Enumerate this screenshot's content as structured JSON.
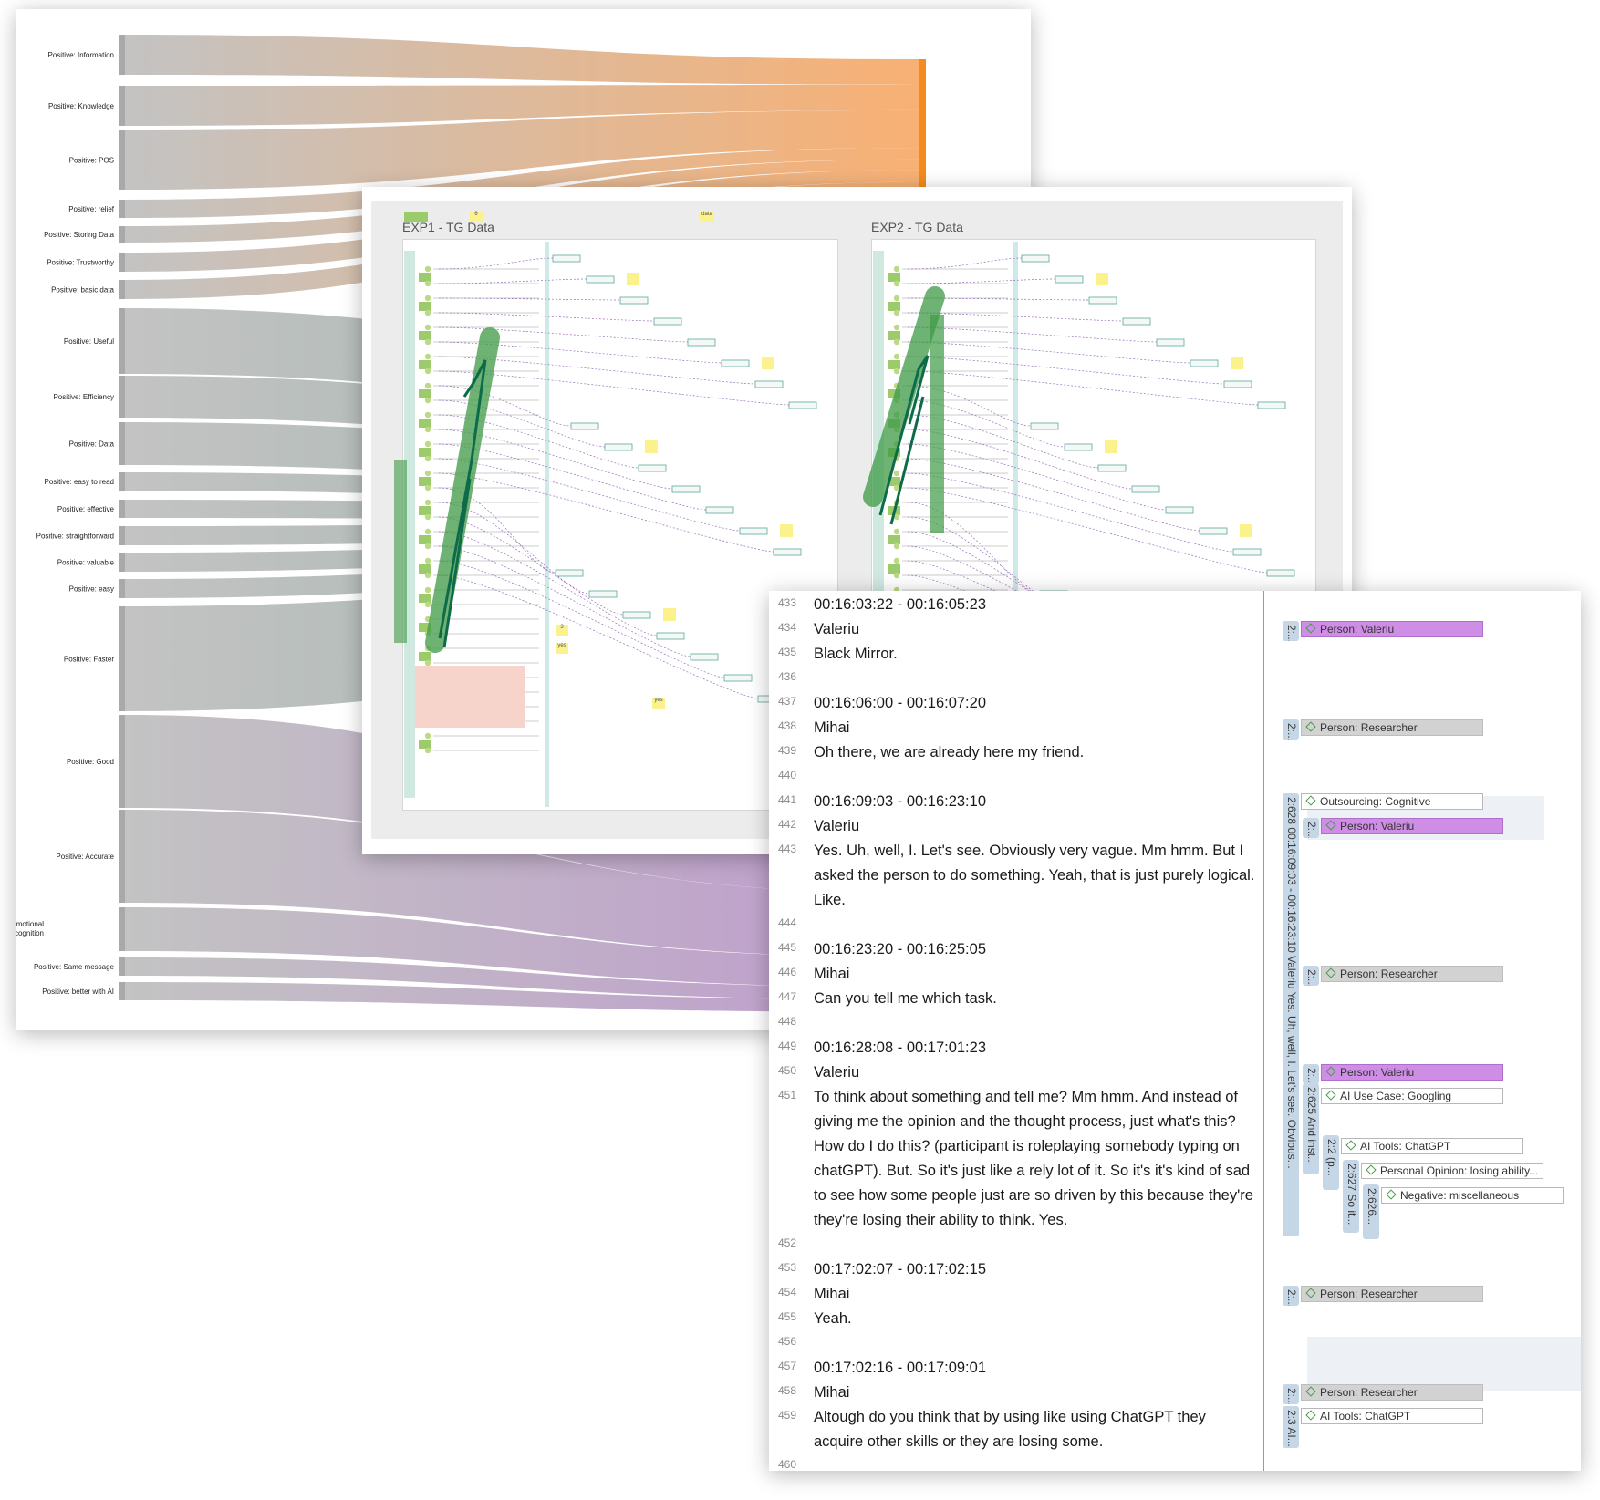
{
  "sankey": {
    "labels": [
      "Positive: Information",
      "Positive: Knowledge",
      "Positive: POS",
      "Positive: relief",
      "Positive: Storing Data",
      "Positive: Trustworthy",
      "Positive: basic data",
      "Positive: Useful",
      "Positive: Efficiency",
      "Positive: Data",
      "Positive: easy to read",
      "Positive: effective",
      "Positive: straightforward",
      "Positive: valuable",
      "Positive: easy",
      "Positive: Faster",
      "Positive: Good",
      "Positive: Accurate",
      "Positive: Emotional recognition",
      "Positive: Same message",
      "Positive: better with AI"
    ],
    "colors": {
      "orange": "#f7a35c",
      "orange_node": "#f58a1f",
      "green": "#8aa69a",
      "purple": "#b48bc5",
      "source": "#b9b9b9"
    }
  },
  "board": {
    "exp1_title": "EXP1 - TG Data",
    "exp2_title": "EXP2 - TG Data",
    "sticky_data": "data",
    "sticky_yes1": "yes",
    "sticky_yes2": "yes",
    "sticky_3": "3",
    "sticky_6": "6",
    "colors": {
      "marker": "#3d9a45",
      "ink": "#0d6b4a",
      "sticky": "#fbf28c",
      "green_card": "#9ccb6c"
    }
  },
  "transcript": {
    "lines": [
      {
        "n": "433",
        "text": "00:16:03:22 - 00:16:05:23"
      },
      {
        "n": "434",
        "text": "Valeriu"
      },
      {
        "n": "435",
        "text": "Black Mirror."
      },
      {
        "n": "436",
        "text": ""
      },
      {
        "n": "437",
        "text": "00:16:06:00 - 00:16:07:20"
      },
      {
        "n": "438",
        "text": "Mihai"
      },
      {
        "n": "439",
        "text": "Oh there, we are already here my friend."
      },
      {
        "n": "440",
        "text": ""
      },
      {
        "n": "441",
        "text": "00:16:09:03 - 00:16:23:10"
      },
      {
        "n": "442",
        "text": "Valeriu"
      },
      {
        "n": "443",
        "text": "Yes. Uh, well, I. Let's see. Obviously very vague. Mm hmm. But I asked the person to do something. Yeah, that is just purely logical. Like."
      },
      {
        "n": "444",
        "text": ""
      },
      {
        "n": "445",
        "text": "00:16:23:20 - 00:16:25:05"
      },
      {
        "n": "446",
        "text": "Mihai"
      },
      {
        "n": "447",
        "text": "Can you tell me which task."
      },
      {
        "n": "448",
        "text": ""
      },
      {
        "n": "449",
        "text": "00:16:28:08 - 00:17:01:23"
      },
      {
        "n": "450",
        "text": "Valeriu"
      },
      {
        "n": "451",
        "text": "To think about something and tell me? Mm hmm. And instead of giving me the opinion and the thought process, just what's this? How do I do this? (participant is roleplaying somebody typing on chatGPT). But. So it's just like a rely lot of it. So it's it's kind of sad to see how some people just are so driven by this because they're they're losing their ability to think. Yes."
      },
      {
        "n": "452",
        "text": ""
      },
      {
        "n": "453",
        "text": "00:17:02:07 - 00:17:02:15"
      },
      {
        "n": "454",
        "text": "Mihai"
      },
      {
        "n": "455",
        "text": "Yeah."
      },
      {
        "n": "456",
        "text": ""
      },
      {
        "n": "457",
        "text": "00:17:02:16 - 00:17:09:01"
      },
      {
        "n": "458",
        "text": "Mihai"
      },
      {
        "n": "459",
        "text": "Altough do you think that by using like using ChatGPT they acquire other skills or they are losing some."
      },
      {
        "n": "460",
        "text": ""
      }
    ],
    "quote_bars": [
      "2:...",
      "2:...",
      "2:628 00:16:09:03 - 00:16:23:10 Valeriu Yes. Uh, well, I. Let's see. Obvious...",
      "2:...",
      "2:...",
      "2:...",
      "2:625 And inst...",
      "2:2 (p...",
      "2:627 So it...",
      "2:626...",
      "2:...",
      "2:...",
      "2:3 AI..."
    ],
    "codes": [
      "Person: Valeriu",
      "Person: Researcher",
      "Outsourcing: Cognitive",
      "Person: Valeriu",
      "Person: Researcher",
      "Person: Valeriu",
      "AI Use Case: Googling",
      "AI Tools: ChatGPT",
      "Personal Opinion: losing ability...",
      "Negative: miscellaneous",
      "Person: Researcher",
      "Person: Researcher",
      "AI Tools: ChatGPT"
    ],
    "colors": {
      "valeriu": "#cf8ee5",
      "researcher": "#d2d2d2",
      "bar": "#c5d6e6"
    }
  }
}
